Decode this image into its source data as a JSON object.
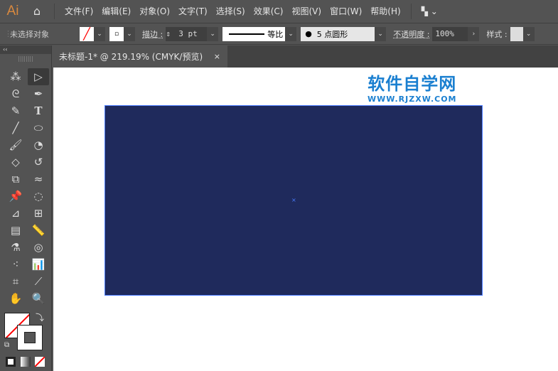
{
  "app": {
    "logo": "Ai",
    "home_icon": "home-icon"
  },
  "menu": [
    "文件(F)",
    "编辑(E)",
    "对象(O)",
    "文字(T)",
    "选择(S)",
    "效果(C)",
    "视图(V)",
    "窗口(W)",
    "帮助(H)"
  ],
  "control": {
    "selection": "未选择对象",
    "stroke_label": "描边 :",
    "stroke_value": "3 pt",
    "profile_label": "等比",
    "brush_value": "5 点圆形",
    "opacity_label": "不透明度 :",
    "opacity_value": "100%",
    "style_label": "样式 :"
  },
  "tab": {
    "title": "未标题-1* @ 219.19% (CMYK/预览)",
    "close": "×"
  },
  "toolbar": {
    "collapse": "‹‹",
    "grip": "||||||||"
  },
  "watermark": {
    "title": "软件自学网",
    "url": "WWW.RJZXW.COM"
  },
  "colors": {
    "artboard": "#1f2a5c",
    "selection": "#4a7cff",
    "logo": "#d9893f"
  }
}
